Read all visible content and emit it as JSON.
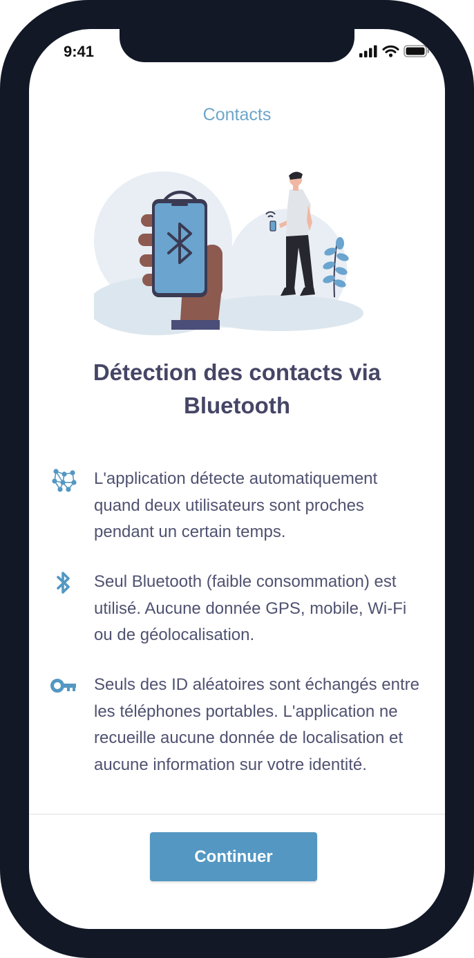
{
  "status_bar": {
    "time": "9:41"
  },
  "header": {
    "title": "Contacts"
  },
  "illustration": {
    "icon": "phone-bluetooth-illustration"
  },
  "headline": "Détection des contacts via Bluetooth",
  "features": [
    {
      "icon": "network-nodes-icon",
      "text": "L'application détecte automatiquement quand deux utilisateurs sont proches pendant un certain temps."
    },
    {
      "icon": "bluetooth-icon",
      "text": "Seul Bluetooth (faible consommation) est utilisé. Aucune donnée GPS, mobile, Wi-Fi ou de géolocalisation."
    },
    {
      "icon": "key-icon",
      "text": "Seuls des ID aléatoires sont échangés entre les téléphones portables. L'application ne recueille aucune donnée de localisation et aucune information sur votre identité."
    }
  ],
  "footer": {
    "continue_label": "Continuer"
  },
  "colors": {
    "accent": "#5497c2",
    "header": "#6ea5c9",
    "headline": "#454566",
    "body_text": "#4f5270",
    "frame": "#121826"
  }
}
